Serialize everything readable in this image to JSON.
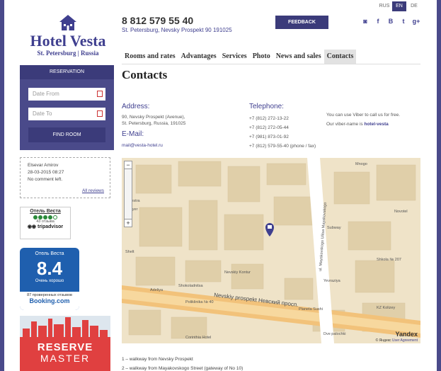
{
  "header": {
    "logo_name": "Hotel Vesta",
    "logo_sub": "St. Petersburg | Russia",
    "phone": "8 812 579 55 40",
    "address": "St. Petersburg, Nevsky Prospekt 90 191025",
    "feedback_label": "FEEDBACK",
    "languages": [
      {
        "code": "RUS",
        "active": false
      },
      {
        "code": "EN",
        "active": true
      },
      {
        "code": "DE",
        "active": false
      }
    ],
    "socials": [
      {
        "icon": "instagram-icon",
        "glyph": "◙"
      },
      {
        "icon": "facebook-icon",
        "glyph": "f"
      },
      {
        "icon": "vk-icon",
        "glyph": "B"
      },
      {
        "icon": "twitter-icon",
        "glyph": "t"
      },
      {
        "icon": "google-plus-icon",
        "glyph": "g+"
      }
    ],
    "accent_color": "#3b3b7a"
  },
  "nav": {
    "items": [
      "Rooms and rates",
      "Advantages",
      "Services",
      "Photo",
      "News and sales",
      "Contacts"
    ],
    "active": "Contacts"
  },
  "sidebar": {
    "reservation_title": "RESERVATION",
    "date_from_placeholder": "Date From",
    "date_to_placeholder": "Date To",
    "find_room_label": "FIND ROOM",
    "review": {
      "author": "Elsevar Amirov",
      "date": "28-03-2015 08:27",
      "text": "No comment left.",
      "all_reviews_label": "All reviews"
    },
    "tripadvisor": {
      "title": "Отель Веста",
      "count": "43 отзыва",
      "logo": "tripadvisor"
    },
    "booking": {
      "hotel": "Отель Веста",
      "score": "8.4",
      "score_word": "Очень хорошо",
      "reviews": "87 проверенных отзывов",
      "logo": "Booking.com"
    },
    "banner": {
      "line1": "RESERVE",
      "line2": "MASTER"
    }
  },
  "main": {
    "title": "Contacts",
    "address_label": "Address:",
    "address_lines": [
      "90, Nevsky Prospekt (Avenue),",
      "St. Petersburg, Russia, 191025"
    ],
    "email_label": "E-Mail:",
    "email": "mail@vesta-hotel.ru",
    "telephone_label": "Telephone:",
    "phones": [
      "+7 (812) 272-13-22",
      "+7 (812) 272-05-44",
      "+7 (981) 873-01-92",
      "+7 (812) 579-55-40 (phone / fax)"
    ],
    "viber_line1": "You can use Viber to call us for free.",
    "viber_prefix": "Our viber-name is ",
    "viber_name": "hotel-vesta",
    "map": {
      "labels": [
        {
          "text": "Nevskiy prospekt Невский просп.",
          "cls": "road"
        },
        {
          "text": "ul. Mayakovskogo Ulitsa Mayakovskogo",
          "cls": "road-v"
        },
        {
          "text": "Subway",
          "cls": "poi"
        },
        {
          "text": "Nevskiy Kontur",
          "cls": "poi"
        },
        {
          "text": "Shokoladnitsa",
          "cls": "poi"
        },
        {
          "text": "Adeliya",
          "cls": "poi"
        },
        {
          "text": "Poliklinika № 40",
          "cls": "poi"
        },
        {
          "text": "Planeta Sushi",
          "cls": "poi"
        },
        {
          "text": "Corinthia Hotel",
          "cls": "poi"
        },
        {
          "text": "Yevraziya",
          "cls": "poi"
        },
        {
          "text": "Shkola № 207",
          "cls": "poi"
        },
        {
          "text": "KZ Kolizey",
          "cls": "poi"
        },
        {
          "text": "Novotel",
          "cls": "poi"
        },
        {
          "text": "Dve palochki",
          "cls": "poi"
        },
        {
          "text": "Vestra",
          "cls": "poi"
        },
        {
          "text": "Mnogo",
          "cls": "poi"
        },
        {
          "text": "Rimyer",
          "cls": "poi"
        },
        {
          "text": "Shelt",
          "cls": "poi"
        }
      ],
      "brand": "Yandex",
      "copyright": "© Яндекс",
      "agreement": "User Agreement"
    },
    "directions": [
      "1 – walkway from Nevsky Prospekt",
      "2 – walkway from Mayakovskogo Street (gateway of No 10)"
    ]
  }
}
